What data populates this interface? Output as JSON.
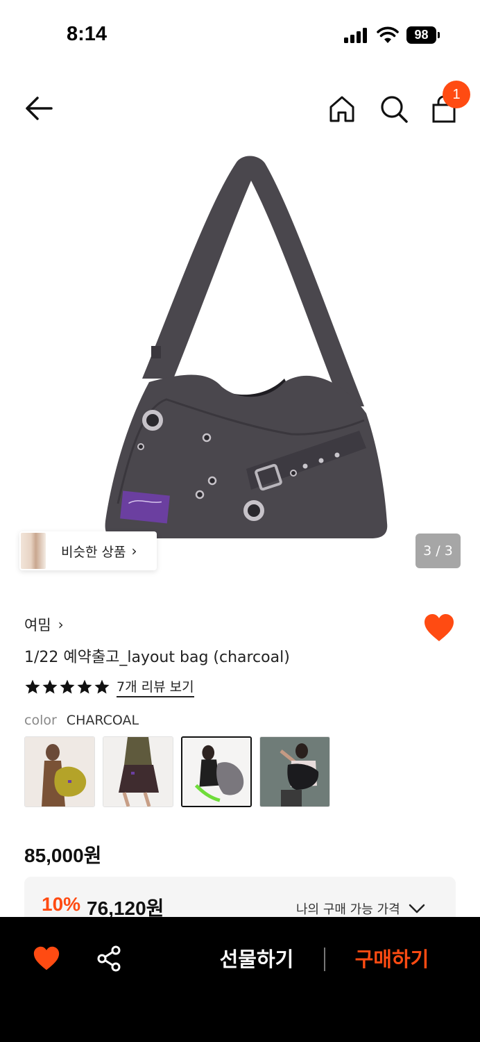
{
  "status_bar": {
    "time": "8:14",
    "battery": "98"
  },
  "nav": {
    "cart_count": "1"
  },
  "gallery": {
    "similar_label": "비슷한 상품",
    "similar_chevron": "›",
    "page_indicator": "3 / 3"
  },
  "product": {
    "brand": "여밈",
    "brand_chevron": "›",
    "title": "1/22 예약출고_layout bag (charcoal)",
    "rating_stars": 5,
    "review_link": "7개 리뷰 보기",
    "color_label": "color",
    "color_value": "CHARCOAL",
    "swatches": [
      "mustard-bag-model",
      "brown-bag-model",
      "charcoal-bag-model",
      "black-bag-model"
    ],
    "selected_swatch": 2,
    "price": "85,000원",
    "discount_rate": "10%",
    "discount_price": "76,120원",
    "my_price_label": "나의 구매 가능 가격"
  },
  "bottom_bar": {
    "gift_label": "선물하기",
    "buy_label": "구매하기"
  },
  "colors": {
    "accent": "#ff4b12",
    "bag": "#4a474d",
    "bottom_bar": "#000000"
  },
  "icons": [
    "back-arrow-icon",
    "home-icon",
    "search-icon",
    "shopping-bag-icon",
    "heart-icon",
    "star-icon",
    "chevron-down-icon",
    "share-icon"
  ]
}
